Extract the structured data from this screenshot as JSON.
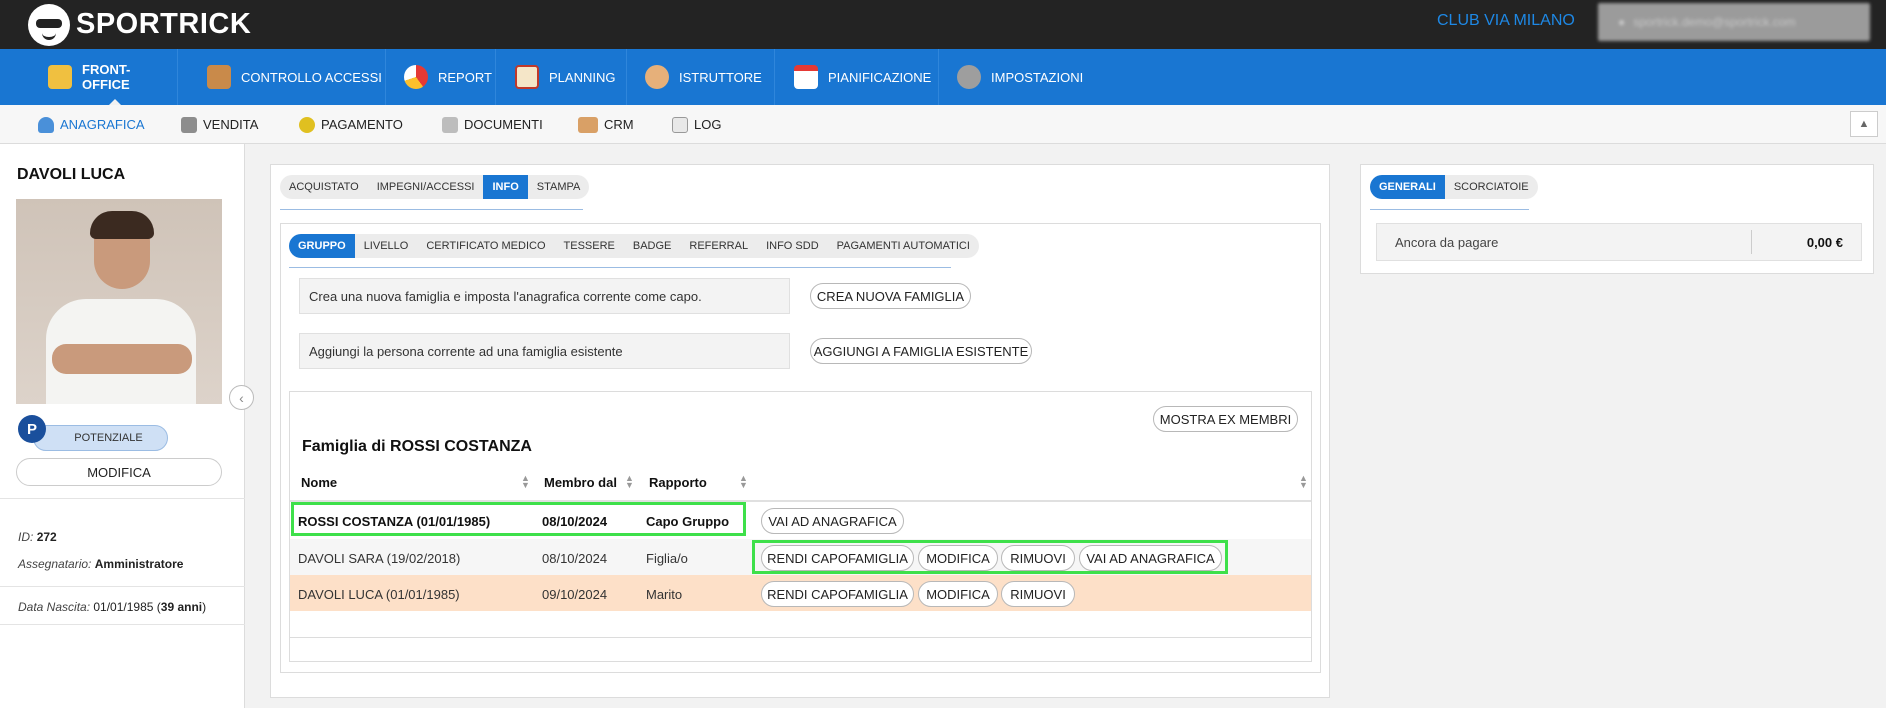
{
  "header": {
    "logo_text": "SPORTRICK",
    "club_name": "CLUB VIA MILANO",
    "user_email": "sportrick.demo@sportrick.com"
  },
  "main_nav": [
    {
      "label": "FRONT-OFFICE",
      "icon": "front-office-icon",
      "active": true
    },
    {
      "label": "CONTROLLO ACCESSI",
      "icon": "access-control-icon",
      "active": false
    },
    {
      "label": "REPORT",
      "icon": "pie-chart-icon",
      "active": false
    },
    {
      "label": "PLANNING",
      "icon": "planning-icon",
      "active": false
    },
    {
      "label": "ISTRUTTORE",
      "icon": "instructor-icon",
      "active": false
    },
    {
      "label": "PIANIFICAZIONE",
      "icon": "calendar-icon",
      "active": false
    },
    {
      "label": "IMPOSTAZIONI",
      "icon": "gear-icon",
      "active": false
    }
  ],
  "sub_nav": [
    {
      "label": "ANAGRAFICA",
      "icon": "person-icon",
      "active": true
    },
    {
      "label": "VENDITA",
      "icon": "cash-register-icon",
      "active": false
    },
    {
      "label": "PAGAMENTO",
      "icon": "coin-icon",
      "active": false
    },
    {
      "label": "DOCUMENTI",
      "icon": "document-icon",
      "active": false
    },
    {
      "label": "CRM",
      "icon": "handshake-icon",
      "active": false
    },
    {
      "label": "LOG",
      "icon": "log-icon",
      "active": false
    }
  ],
  "sidebar": {
    "name": "DAVOLI LUCA",
    "badge_letter": "P",
    "status": "POTENZIALE",
    "modify_label": "MODIFICA",
    "id_label": "ID:",
    "id_value": "272",
    "assignee_label": "Assegnatario:",
    "assignee_value": "Amministratore",
    "birth_label": "Data Nascita:",
    "birth_value": "01/01/1985 (",
    "age_value": "39 anni",
    "age_close": ")"
  },
  "center": {
    "tabs": [
      "ACQUISTATO",
      "IMPEGNI/ACCESSI",
      "INFO",
      "STAMPA"
    ],
    "active_tab": "INFO",
    "inner_tabs": [
      "GRUPPO",
      "LIVELLO",
      "CERTIFICATO MEDICO",
      "TESSERE",
      "BADGE",
      "REFERRAL",
      "INFO SDD",
      "PAGAMENTI AUTOMATICI"
    ],
    "active_inner_tab": "GRUPPO",
    "create_desc": "Crea una nuova famiglia e imposta l'anagrafica corrente come capo.",
    "create_btn": "CREA NUOVA FAMIGLIA",
    "add_desc": "Aggiungi la persona corrente ad una famiglia esistente",
    "add_btn": "AGGIUNGI A FAMIGLIA ESISTENTE",
    "show_ex_btn": "MOSTRA EX MEMBRI",
    "family_title": "Famiglia di ROSSI COSTANZA",
    "columns": [
      "Nome",
      "Membro dal",
      "Rapporto"
    ],
    "rows": [
      {
        "name": "ROSSI COSTANZA (01/01/1985)",
        "since": "08/10/2024",
        "relation": "Capo Gruppo",
        "actions": [
          "VAI AD ANAGRAFICA"
        ]
      },
      {
        "name": "DAVOLI SARA (19/02/2018)",
        "since": "08/10/2024",
        "relation": "Figlia/o",
        "actions": [
          "RENDI CAPOFAMIGLIA",
          "MODIFICA",
          "RIMUOVI",
          "VAI AD ANAGRAFICA"
        ]
      },
      {
        "name": "DAVOLI LUCA (01/01/1985)",
        "since": "09/10/2024",
        "relation": "Marito",
        "actions": [
          "RENDI CAPOFAMIGLIA",
          "MODIFICA",
          "RIMUOVI"
        ]
      }
    ]
  },
  "right": {
    "tabs": [
      "GENERALI",
      "SCORCIATOIE"
    ],
    "active_tab": "GENERALI",
    "due_label": "Ancora da pagare",
    "due_value": "0,00 €"
  },
  "colors": {
    "brand_blue": "#1976d2",
    "topbar": "#232323",
    "highlight_green": "#3ee04a",
    "current_row": "#fde0c8"
  }
}
